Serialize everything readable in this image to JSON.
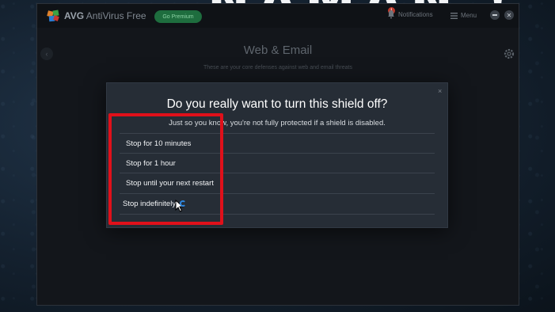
{
  "background": {
    "banner_text": "NAMAN !"
  },
  "app": {
    "brand": "AVG",
    "product": "AntiVirus Free",
    "premium_label": "Go Premium",
    "notification_count": "1",
    "notifications_label": "Notifications",
    "menu_label": "Menu"
  },
  "page": {
    "title": "Web & Email",
    "subtitle": "These are your core defenses against web and email threats"
  },
  "dialog": {
    "title": "Do you really want to turn this shield off?",
    "subtitle": "Just so you know, you're not fully protected if a shield is disabled.",
    "options": [
      "Stop for 10 minutes",
      "Stop for 1 hour",
      "Stop until your next restart",
      "Stop indefinitely"
    ],
    "close_symbol": "×"
  },
  "colors": {
    "highlight": "#e0101a",
    "dialog_bg": "#262d36",
    "app_bg": "#13161b"
  }
}
